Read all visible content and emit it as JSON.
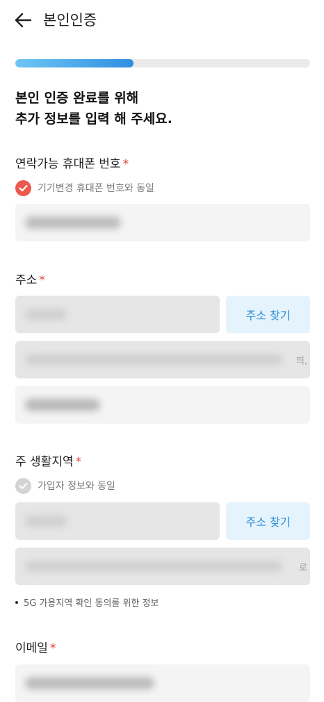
{
  "header": {
    "title": "본인인증",
    "back_icon": "arrow-left-icon"
  },
  "progress": {
    "fraction": 0.4
  },
  "heading": {
    "line1": "본인 인증 완료를 위해",
    "line2": "추가 정보를 입력 해 주세요."
  },
  "phone_section": {
    "label": "연락가능 휴대폰 번호",
    "required": "*",
    "checkbox_label": "기기변경 휴대폰 번호와 동일",
    "checkbox_checked": true,
    "field_value": "(blurred)"
  },
  "address_section": {
    "label": "주소",
    "required": "*",
    "search_button": "주소 찾기",
    "zipcode_value": "(blurred)",
    "address_value": "(blurred)",
    "address_overflow_text": "띄,",
    "detail_value": "(blurred)"
  },
  "living_area_section": {
    "label": "주 생활지역",
    "required": "*",
    "checkbox_label": "가입자 정보와 동일",
    "checkbox_checked": false,
    "search_button": "주소 찾기",
    "zipcode_value": "(blurred)",
    "address_value": "(blurred)",
    "address_overflow_text": "로",
    "note": "5G 가용지역 확인 동의를 위한 정보"
  },
  "email_section": {
    "label": "이메일",
    "required": "*",
    "field_value": "(blurred)"
  },
  "colors": {
    "accent_blue": "#2b8ed8",
    "required_red": "#e0463a",
    "check_red": "#ea5a4d"
  }
}
